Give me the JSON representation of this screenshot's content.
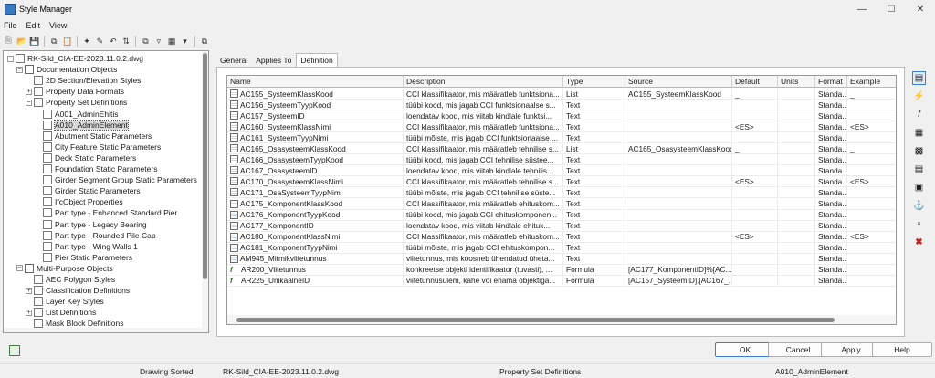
{
  "window": {
    "title": "Style Manager"
  },
  "menu": {
    "items": [
      "File",
      "Edit",
      "View"
    ]
  },
  "tree": {
    "nodes": [
      {
        "label": "RK-Sild_CIA-EE-2023.11.0.2.dwg",
        "level": 0,
        "exp": "−",
        "icon": "drawing-icon"
      },
      {
        "label": "Documentation Objects",
        "level": 1,
        "exp": "−",
        "icon": "folder-icon"
      },
      {
        "label": "2D Section/Elevation Styles",
        "level": 2,
        "exp": "",
        "icon": "section-style-icon"
      },
      {
        "label": "Property Data Formats",
        "level": 2,
        "exp": "+",
        "icon": "data-format-icon"
      },
      {
        "label": "Property Set Definitions",
        "level": 2,
        "exp": "−",
        "icon": "property-set-icon"
      },
      {
        "label": "A001_AdminEhitis",
        "level": 3,
        "exp": "",
        "icon": "property-set-icon"
      },
      {
        "label": "A010_AdminElement",
        "level": 3,
        "exp": "",
        "icon": "property-set-icon",
        "selected": true
      },
      {
        "label": "Abutment Static Parameters",
        "level": 3,
        "exp": "",
        "icon": "property-set-icon"
      },
      {
        "label": "City Feature Static Parameters",
        "level": 3,
        "exp": "",
        "icon": "property-set-icon"
      },
      {
        "label": "Deck Static Parameters",
        "level": 3,
        "exp": "",
        "icon": "property-set-icon"
      },
      {
        "label": "Foundation Static Parameters",
        "level": 3,
        "exp": "",
        "icon": "property-set-icon"
      },
      {
        "label": "Girder Segment Group Static Parameters",
        "level": 3,
        "exp": "",
        "icon": "property-set-icon"
      },
      {
        "label": "Girder Static Parameters",
        "level": 3,
        "exp": "",
        "icon": "property-set-icon"
      },
      {
        "label": "IfcObject Properties",
        "level": 3,
        "exp": "",
        "icon": "property-set-icon"
      },
      {
        "label": "Part type - Enhanced Standard Pier",
        "level": 3,
        "exp": "",
        "icon": "property-set-icon"
      },
      {
        "label": "Part type - Legacy Bearing",
        "level": 3,
        "exp": "",
        "icon": "property-set-icon"
      },
      {
        "label": "Part type - Rounded Pile Cap",
        "level": 3,
        "exp": "",
        "icon": "property-set-icon"
      },
      {
        "label": "Part type - Wing Walls 1",
        "level": 3,
        "exp": "",
        "icon": "property-set-icon"
      },
      {
        "label": "Pier Static Parameters",
        "level": 3,
        "exp": "",
        "icon": "property-set-icon"
      },
      {
        "label": "Multi-Purpose Objects",
        "level": 1,
        "exp": "−",
        "icon": "folder-icon"
      },
      {
        "label": "AEC Polygon Styles",
        "level": 2,
        "exp": "",
        "icon": "polygon-style-icon"
      },
      {
        "label": "Classification Definitions",
        "level": 2,
        "exp": "+",
        "icon": "classification-icon"
      },
      {
        "label": "Layer Key Styles",
        "level": 2,
        "exp": "",
        "icon": "layer-key-icon"
      },
      {
        "label": "List Definitions",
        "level": 2,
        "exp": "+",
        "icon": "list-definition-icon"
      },
      {
        "label": "Mask Block Definitions",
        "level": 2,
        "exp": "",
        "icon": "mask-block-icon"
      }
    ]
  },
  "tabs": [
    {
      "label": "General",
      "active": false
    },
    {
      "label": "Applies To",
      "active": false
    },
    {
      "label": "Definition",
      "active": true
    }
  ],
  "grid": {
    "columns": [
      "Name",
      "Description",
      "Type",
      "Source",
      "Default",
      "Units",
      "Format",
      "Example"
    ],
    "rows": [
      {
        "icon": "list",
        "name": "AC155_SysteemKlassKood",
        "description": "CCI klassifikaator, mis määratleb funktsiona...",
        "type": "List",
        "source": "AC155_SysteemKlassKood",
        "default": "_",
        "units": "",
        "format": "Standa...",
        "example": "_"
      },
      {
        "icon": "list",
        "name": "AC156_SysteemTyypKood",
        "description": "tüübi kood, mis jagab CCI funktsionaalse s...",
        "type": "Text",
        "source": "",
        "default": "",
        "units": "",
        "format": "Standa...",
        "example": ""
      },
      {
        "icon": "list",
        "name": "AC157_SysteemID",
        "description": "loendatav kood, mis viitab kindlale funktsi...",
        "type": "Text",
        "source": "",
        "default": "",
        "units": "",
        "format": "Standa...",
        "example": ""
      },
      {
        "icon": "list",
        "name": "AC160_SysteemKlassNimi",
        "description": "CCI klassifikaator, mis määratleb funktsiona...",
        "type": "Text",
        "source": "",
        "default": "<ES>",
        "units": "",
        "format": "Standa...",
        "example": "<ES>"
      },
      {
        "icon": "list",
        "name": "AC161_SysteemTyypNimi",
        "description": "tüübi mõiste, mis jagab CCI funktsionaalse ...",
        "type": "Text",
        "source": "",
        "default": "",
        "units": "",
        "format": "Standa...",
        "example": ""
      },
      {
        "icon": "list",
        "name": "AC165_OsasysteemKlassKood",
        "description": "CCI klassifikaator, mis määratleb tehnilise s...",
        "type": "List",
        "source": "AC165_OsasysteemKlassKood",
        "default": "_",
        "units": "",
        "format": "Standa...",
        "example": "_"
      },
      {
        "icon": "list",
        "name": "AC166_OsasysteemTyypKood",
        "description": "tüübi kood, mis jagab CCI tehnilise süstee...",
        "type": "Text",
        "source": "",
        "default": "",
        "units": "",
        "format": "Standa...",
        "example": ""
      },
      {
        "icon": "list",
        "name": "AC167_OsasysteemID",
        "description": "loendatav kood, mis viitab kindlale tehnilis...",
        "type": "Text",
        "source": "",
        "default": "",
        "units": "",
        "format": "Standa...",
        "example": ""
      },
      {
        "icon": "list",
        "name": "AC170_OsasysteemKlassNimi",
        "description": "CCI klassifikaator, mis määratleb tehnilise s...",
        "type": "Text",
        "source": "",
        "default": "<ES>",
        "units": "",
        "format": "Standa...",
        "example": "<ES>"
      },
      {
        "icon": "list",
        "name": "AC171_OsaSysteemTyypNimi",
        "description": "tüübi mõiste, mis jagab CCI tehnilise süste...",
        "type": "Text",
        "source": "",
        "default": "",
        "units": "",
        "format": "Standa...",
        "example": ""
      },
      {
        "icon": "list",
        "name": "AC175_KomponentKlassKood",
        "description": "CCI klassifikaator, mis määratleb ehituskom...",
        "type": "Text",
        "source": "",
        "default": "",
        "units": "",
        "format": "Standa...",
        "example": ""
      },
      {
        "icon": "list",
        "name": "AC176_KomponentTyypKood",
        "description": "tüübi kood, mis jagab CCI ehituskomponen...",
        "type": "Text",
        "source": "",
        "default": "",
        "units": "",
        "format": "Standa...",
        "example": ""
      },
      {
        "icon": "list",
        "name": "AC177_KomponentID",
        "description": "loendatav kood, mis viitab kindlale ehituk...",
        "type": "Text",
        "source": "",
        "default": "",
        "units": "",
        "format": "Standa...",
        "example": ""
      },
      {
        "icon": "list",
        "name": "AC180_KomponentKlassNimi",
        "description": "CCI klassifikaator, mis määratleb ehituskom...",
        "type": "Text",
        "source": "",
        "default": "<ES>",
        "units": "",
        "format": "Standa...",
        "example": "<ES>"
      },
      {
        "icon": "list",
        "name": "AC181_KomponentTyypNimi",
        "description": "tüübi mõiste, mis jagab CCI ehituskompon...",
        "type": "Text",
        "source": "",
        "default": "",
        "units": "",
        "format": "Standa...",
        "example": ""
      },
      {
        "icon": "list",
        "name": "AM945_Mitmikviitetunnus",
        "description": "viitetunnus, mis koosneb ühendatud üheta...",
        "type": "Text",
        "source": "",
        "default": "",
        "units": "",
        "format": "Standa...",
        "example": ""
      },
      {
        "icon": "fx",
        "name": "AR200_Viitetunnus",
        "description": "konkreetse objekti identifikaator (tuvasti), ...",
        "type": "Formula",
        "source": "[AC177_KomponentID]%[AC...",
        "default": "",
        "units": "",
        "format": "Standa...",
        "example": ""
      },
      {
        "icon": "fx",
        "name": "AR225_UnikaalneID",
        "description": "viitetunnusülem, kahe või enama objektiga...",
        "type": "Formula",
        "source": "[AC157_SysteemID].[AC167_...",
        "default": "",
        "units": "",
        "format": "Standa...",
        "example": ""
      }
    ]
  },
  "right_tools": [
    "add-property-icon",
    "add-automatic-property-icon",
    "add-formula-property-icon",
    "add-location-property-icon",
    "add-classification-property-icon",
    "add-material-property-icon",
    "add-project-property-icon",
    "add-anchor-property-icon",
    "add-graphic-property-icon",
    "delete-property-icon"
  ],
  "buttons": {
    "ok": "OK",
    "cancel": "Cancel",
    "apply": "Apply",
    "help": "Help"
  },
  "status": {
    "sort": "Drawing Sorted",
    "file": "RK-Sild_CIA-EE-2023.11.0.2.dwg",
    "category": "Property Set Definitions",
    "style": "A010_AdminElement"
  },
  "colors": {
    "accent": "#3b7fd4",
    "delete": "#d32020",
    "add": "#2b9a2b"
  }
}
